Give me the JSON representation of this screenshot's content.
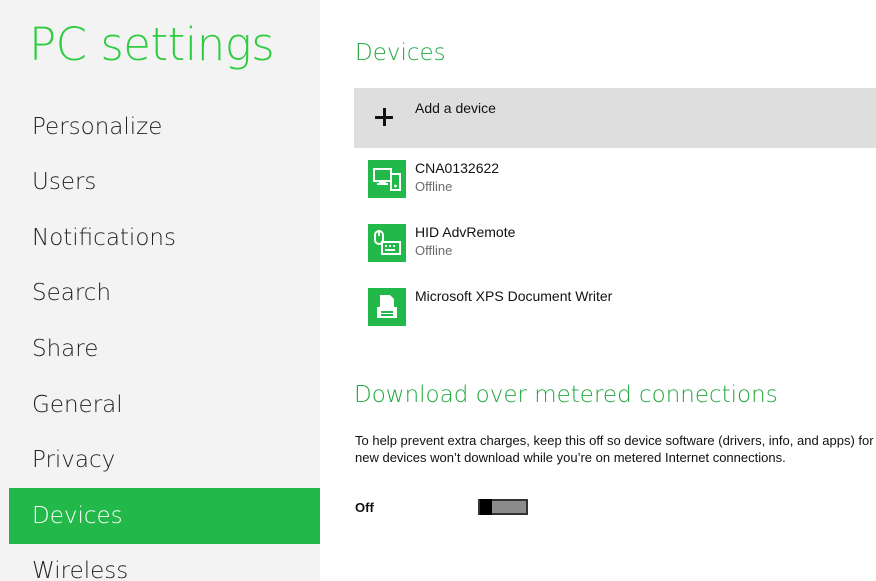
{
  "sidebar": {
    "title": "PC settings",
    "items": [
      {
        "label": "Personalize",
        "active": false
      },
      {
        "label": "Users",
        "active": false
      },
      {
        "label": "Notifications",
        "active": false
      },
      {
        "label": "Search",
        "active": false
      },
      {
        "label": "Share",
        "active": false
      },
      {
        "label": "General",
        "active": false
      },
      {
        "label": "Privacy",
        "active": false
      },
      {
        "label": "Devices",
        "active": true
      },
      {
        "label": "Wireless",
        "active": false
      }
    ]
  },
  "devices": {
    "title": "Devices",
    "add_label": "Add a device",
    "list": [
      {
        "name": "CNA0132622",
        "status": "Offline",
        "icon": "computer-phone-icon"
      },
      {
        "name": "HID AdvRemote",
        "status": "Offline",
        "icon": "mouse-keyboard-icon"
      },
      {
        "name": "Microsoft XPS Document Writer",
        "status": "",
        "icon": "printer-icon"
      }
    ]
  },
  "metered": {
    "title": "Download over metered connections",
    "description": "To help prevent extra charges, keep this off so device software (drivers, info, and apps) for new devices won’t download while you’re on metered Internet connections.",
    "toggle_label": "Off",
    "toggle_on": false
  },
  "colors": {
    "accent": "#22b84a",
    "accent_text": "#1fa83d",
    "sidebar_bg": "#f3f3f3",
    "add_bg": "#dedede"
  }
}
